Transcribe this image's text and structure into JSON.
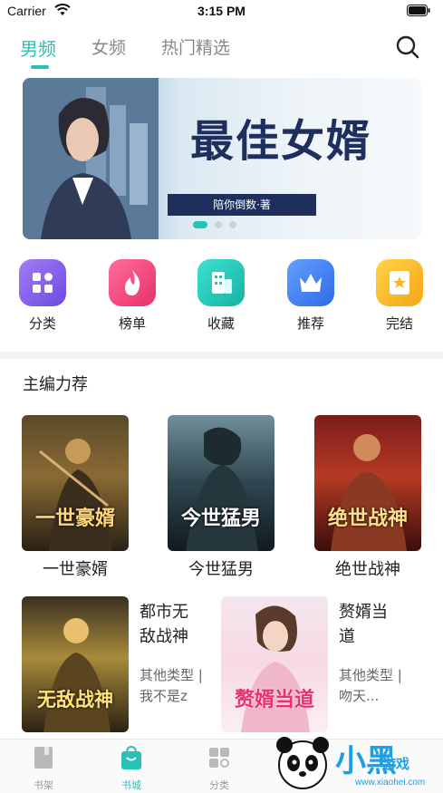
{
  "status": {
    "carrier": "Carrier",
    "time": "3:15 PM"
  },
  "tabs": [
    {
      "label": "男频",
      "active": true
    },
    {
      "label": "女频",
      "active": false
    },
    {
      "label": "热门精选",
      "active": false
    }
  ],
  "banner": {
    "title": "最佳女婿",
    "author": "陪你倒数·著",
    "pages": 3,
    "current_page": 1
  },
  "categories": [
    {
      "label": "分类",
      "icon": "grid-icon",
      "color": "#8e63f0"
    },
    {
      "label": "榜单",
      "icon": "flame-icon",
      "color": "#f0467a"
    },
    {
      "label": "收藏",
      "icon": "building-icon",
      "color": "#1fc7b8"
    },
    {
      "label": "推荐",
      "icon": "crown-icon",
      "color": "#3d7ff0"
    },
    {
      "label": "完结",
      "icon": "star-book-icon",
      "color": "#f7b52a"
    }
  ],
  "section": {
    "title": "主编力荐"
  },
  "books_grid": [
    {
      "name": "一世豪婿",
      "cover_text": "一世豪婿"
    },
    {
      "name": "今世猛男",
      "cover_text": "今世猛男"
    },
    {
      "name": "绝世战神",
      "cover_text": "绝世战神"
    }
  ],
  "books_list": [
    {
      "title": "都市无敌战神",
      "meta": "其他类型 | 我不是z",
      "cover_text": "无敌战神"
    },
    {
      "title": "赘婿当道",
      "meta": "其他类型 | 吻天...",
      "cover_text": "赘婿当道"
    }
  ],
  "bottom_nav": [
    {
      "label": "书架",
      "icon": "bookshelf-icon",
      "active": false
    },
    {
      "label": "书城",
      "icon": "bookstore-icon",
      "active": true
    },
    {
      "label": "分类",
      "icon": "category-icon",
      "active": false
    }
  ],
  "watermark": {
    "title": "小黑",
    "sub": "游戏",
    "url": "www.xiaohei.com"
  },
  "colors": {
    "accent": "#26c2b8"
  }
}
